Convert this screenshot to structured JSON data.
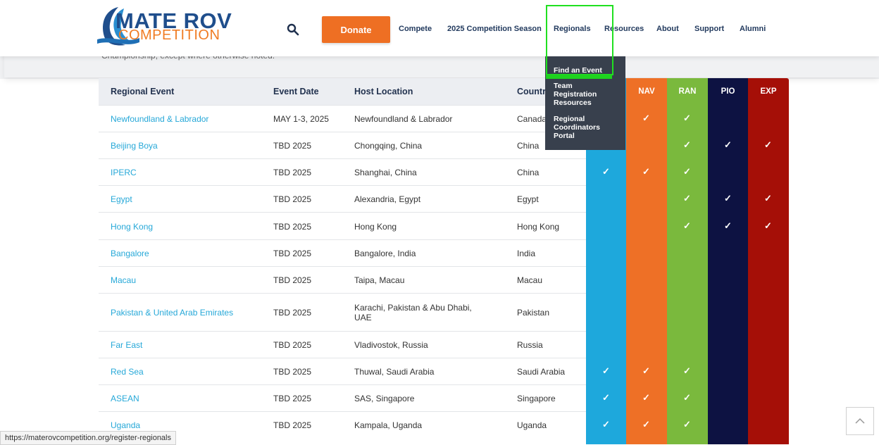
{
  "header": {
    "logo_line1": "MATE ROV",
    "logo_line2": "COMPETITION",
    "donate_label": "Donate",
    "nav": [
      "Compete",
      "2025 Competition Season",
      "Regionals",
      "Resources",
      "About",
      "Support",
      "Alumni"
    ]
  },
  "background_text": "Championship, except where otherwise noted.",
  "dropdown": {
    "items": [
      "Find an Event",
      "Team Registration Resources",
      "Regional Coordinators Portal"
    ]
  },
  "table": {
    "headers": [
      "Regional Event",
      "Event Date",
      "Host Location",
      "Country"
    ],
    "class_headers": [
      "",
      "NAV",
      "RAN",
      "PIO",
      "EXP"
    ],
    "rows": [
      {
        "event": "Newfoundland & Labrador",
        "date": "MAY 1-3, 2025",
        "location": "Newfoundland & Labrador",
        "country": "Canada",
        "checks": [
          false,
          true,
          true,
          false,
          false
        ]
      },
      {
        "event": "Beijing Boya",
        "date": "TBD 2025",
        "location": "Chongqing, China",
        "country": "China",
        "checks": [
          false,
          false,
          true,
          true,
          true
        ]
      },
      {
        "event": "IPERC",
        "date": "TBD 2025",
        "location": "Shanghai, China",
        "country": "China",
        "checks": [
          true,
          true,
          true,
          false,
          false
        ]
      },
      {
        "event": "Egypt",
        "date": "TBD 2025",
        "location": "Alexandria, Egypt",
        "country": "Egypt",
        "checks": [
          false,
          false,
          true,
          true,
          true
        ]
      },
      {
        "event": "Hong Kong",
        "date": "TBD 2025",
        "location": "Hong Kong",
        "country": "Hong Kong",
        "checks": [
          false,
          false,
          true,
          true,
          true
        ]
      },
      {
        "event": "Bangalore",
        "date": "TBD 2025",
        "location": "Bangalore, India",
        "country": "India",
        "checks": [
          false,
          false,
          false,
          false,
          false
        ]
      },
      {
        "event": "Macau",
        "date": "TBD 2025",
        "location": "Taipa, Macau",
        "country": "Macau",
        "checks": [
          false,
          false,
          false,
          false,
          false
        ]
      },
      {
        "event": "Pakistan & United Arab Emirates",
        "date": "TBD 2025",
        "location": "Karachi, Pakistan & Abu Dhabi, UAE",
        "country": "Pakistan",
        "checks": [
          false,
          false,
          false,
          false,
          false
        ]
      },
      {
        "event": "Far East",
        "date": "TBD 2025",
        "location": "Vladivostok, Russia",
        "country": "Russia",
        "checks": [
          false,
          false,
          false,
          false,
          false
        ]
      },
      {
        "event": "Red Sea",
        "date": "TBD 2025",
        "location": "Thuwal, Saudi Arabia",
        "country": "Saudi Arabia",
        "checks": [
          true,
          true,
          true,
          false,
          false
        ]
      },
      {
        "event": "ASEAN",
        "date": "TBD 2025",
        "location": "SAS, Singapore",
        "country": "Singapore",
        "checks": [
          true,
          true,
          true,
          false,
          false
        ]
      },
      {
        "event": "Uganda",
        "date": "TBD 2025",
        "location": "Kampala, Uganda",
        "country": "Uganda",
        "checks": [
          true,
          true,
          true,
          false,
          false
        ]
      }
    ],
    "check_glyph": "✓",
    "class_colors": [
      "#1ea8dc",
      "#ee7026",
      "#7ab93d",
      "#0d1242",
      "#a50f07"
    ]
  },
  "status_bar": "https://materovcompetition.org/register-regionals",
  "icons": {
    "search": "search-icon",
    "scroll_top": "chevron-up-icon"
  }
}
